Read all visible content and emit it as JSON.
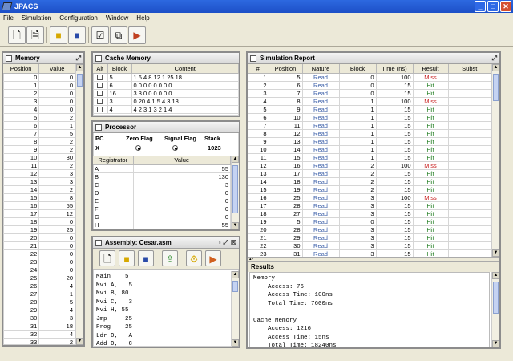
{
  "window": {
    "title": "JPACS"
  },
  "menu": [
    "File",
    "Simulation",
    "Configuration",
    "Window",
    "Help"
  ],
  "toolbar": {
    "icons": [
      "new-icon",
      "document-icon",
      "open-folder-icon",
      "save-icon",
      "checklist-icon",
      "copy-icon",
      "run-icon"
    ]
  },
  "memory": {
    "title": "Memory",
    "columns": [
      "Position",
      "Value"
    ],
    "rows": [
      [
        "0",
        "0"
      ],
      [
        "1",
        "0"
      ],
      [
        "2",
        "0"
      ],
      [
        "3",
        "0"
      ],
      [
        "4",
        "0"
      ],
      [
        "5",
        "2"
      ],
      [
        "6",
        "1"
      ],
      [
        "7",
        "5"
      ],
      [
        "8",
        "2"
      ],
      [
        "9",
        "2"
      ],
      [
        "10",
        "80"
      ],
      [
        "11",
        "2"
      ],
      [
        "12",
        "3"
      ],
      [
        "13",
        "3"
      ],
      [
        "14",
        "2"
      ],
      [
        "15",
        "8"
      ],
      [
        "16",
        "55"
      ],
      [
        "17",
        "12"
      ],
      [
        "18",
        "0"
      ],
      [
        "19",
        "25"
      ],
      [
        "20",
        "0"
      ],
      [
        "21",
        "0"
      ],
      [
        "22",
        "0"
      ],
      [
        "23",
        "0"
      ],
      [
        "24",
        "0"
      ],
      [
        "25",
        "20"
      ],
      [
        "26",
        "4"
      ],
      [
        "27",
        "1"
      ],
      [
        "28",
        "5"
      ],
      [
        "29",
        "4"
      ],
      [
        "30",
        "3"
      ],
      [
        "31",
        "18"
      ],
      [
        "32",
        "4"
      ],
      [
        "33",
        "2"
      ]
    ]
  },
  "cache": {
    "title": "Cache Memory",
    "columns": [
      "Alt",
      "Block",
      "Content"
    ],
    "rows": [
      [
        "5",
        "1 6 4 8 12 1 25 18"
      ],
      [
        "6",
        "0 0 0 0 0 0 0 0"
      ],
      [
        "16",
        "3 3 0 0 0 0 0 0"
      ],
      [
        "3",
        "0 20 4 1 5 4 3 18"
      ],
      [
        "4",
        "4 2 3 1 3 2 1 4"
      ]
    ]
  },
  "processor": {
    "title": "Processor",
    "headers": [
      "PC",
      "Zero Flag",
      "Signal Flag",
      "Stack"
    ],
    "pc": "X",
    "stack": "1023",
    "columns": [
      "Registrator",
      "Value"
    ],
    "rows": [
      [
        "A",
        "55"
      ],
      [
        "B",
        "130"
      ],
      [
        "C",
        "3"
      ],
      [
        "D",
        "0"
      ],
      [
        "E",
        "0"
      ],
      [
        "F",
        "0"
      ],
      [
        "G",
        "0"
      ],
      [
        "H",
        "55"
      ]
    ]
  },
  "assembly": {
    "title": "Assembly: Cesar.asm",
    "icons": [
      "new-icon",
      "open-folder-icon",
      "save-icon",
      "export-icon",
      "compile-icon",
      "run-icon"
    ],
    "lines": [
      "Main    5",
      "Mvi A,   5",
      "Mvi B, 80",
      "Mvi C,   3",
      "Mvi H, 55",
      "Jmp     25",
      "Prog    25",
      "Ldr D,   A",
      "Add D,   C"
    ]
  },
  "report": {
    "title": "Simulation Report",
    "columns": [
      "#",
      "Position",
      "Nature",
      "Block",
      "Time (ns)",
      "Result",
      "Subst"
    ],
    "rows": [
      [
        "1",
        "5",
        "Read",
        "0",
        "100",
        "Miss",
        ""
      ],
      [
        "2",
        "6",
        "Read",
        "0",
        "15",
        "Hit",
        ""
      ],
      [
        "3",
        "7",
        "Read",
        "0",
        "15",
        "Hit",
        ""
      ],
      [
        "4",
        "8",
        "Read",
        "1",
        "100",
        "Miss",
        ""
      ],
      [
        "5",
        "9",
        "Read",
        "1",
        "15",
        "Hit",
        ""
      ],
      [
        "6",
        "10",
        "Read",
        "1",
        "15",
        "Hit",
        ""
      ],
      [
        "7",
        "11",
        "Read",
        "1",
        "15",
        "Hit",
        ""
      ],
      [
        "8",
        "12",
        "Read",
        "1",
        "15",
        "Hit",
        ""
      ],
      [
        "9",
        "13",
        "Read",
        "1",
        "15",
        "Hit",
        ""
      ],
      [
        "10",
        "14",
        "Read",
        "1",
        "15",
        "Hit",
        ""
      ],
      [
        "11",
        "15",
        "Read",
        "1",
        "15",
        "Hit",
        ""
      ],
      [
        "12",
        "16",
        "Read",
        "2",
        "100",
        "Miss",
        ""
      ],
      [
        "13",
        "17",
        "Read",
        "2",
        "15",
        "Hit",
        ""
      ],
      [
        "14",
        "18",
        "Read",
        "2",
        "15",
        "Hit",
        ""
      ],
      [
        "15",
        "19",
        "Read",
        "2",
        "15",
        "Hit",
        ""
      ],
      [
        "16",
        "25",
        "Read",
        "3",
        "100",
        "Miss",
        ""
      ],
      [
        "17",
        "28",
        "Read",
        "3",
        "15",
        "Hit",
        ""
      ],
      [
        "18",
        "27",
        "Read",
        "3",
        "15",
        "Hit",
        ""
      ],
      [
        "19",
        "5",
        "Read",
        "0",
        "15",
        "Hit",
        ""
      ],
      [
        "20",
        "28",
        "Read",
        "3",
        "15",
        "Hit",
        ""
      ],
      [
        "21",
        "29",
        "Read",
        "3",
        "15",
        "Hit",
        ""
      ],
      [
        "22",
        "30",
        "Read",
        "3",
        "15",
        "Hit",
        ""
      ],
      [
        "23",
        "31",
        "Read",
        "3",
        "15",
        "Hit",
        ""
      ]
    ]
  },
  "results": {
    "title": "Results",
    "lines": [
      "Memory",
      "    Access: 76",
      "    Access Time: 100ns",
      "    Total Time: 7600ns",
      "",
      "Cache Memory",
      "    Access: 1216",
      "    Access Time: 15ns",
      "    Total Time: 18240ns"
    ]
  }
}
